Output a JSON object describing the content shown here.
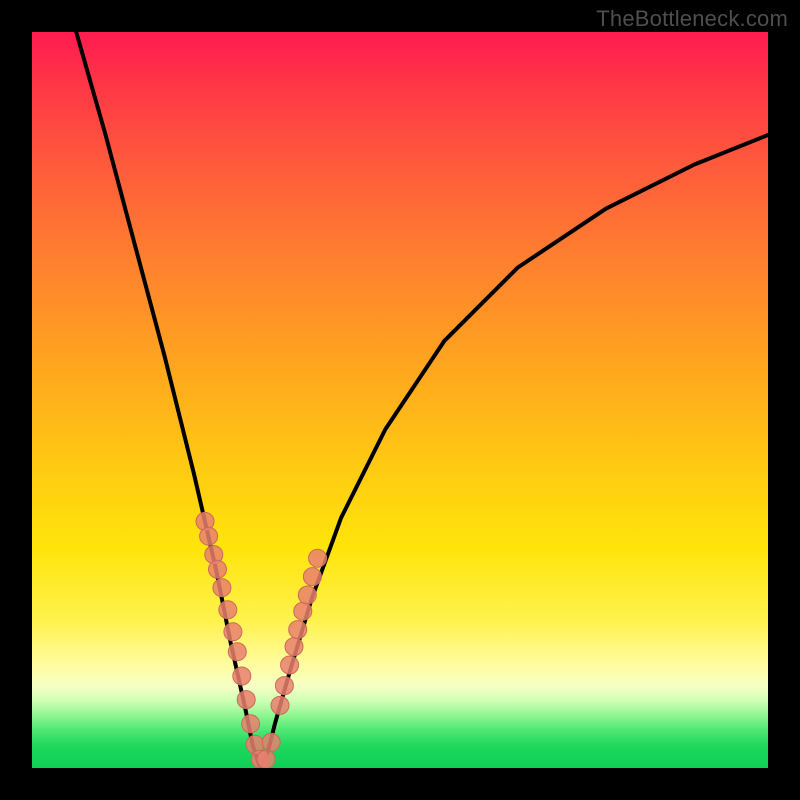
{
  "watermark": "TheBottleneck.com",
  "colors": {
    "frame": "#000000",
    "curve_stroke": "#000000",
    "marker_fill": "#e9806f",
    "marker_stroke": "#c96a5b"
  },
  "chart_data": {
    "type": "line",
    "title": "",
    "xlabel": "",
    "ylabel": "",
    "xlim": [
      0,
      100
    ],
    "ylim": [
      0,
      100
    ],
    "note": "x and y on 0-100 scale; y maps to bottleneck % (0 = green bottom, 100 = red top). V-shaped curve with trough near x≈31, y≈0.",
    "series": [
      {
        "name": "bottleneck-curve",
        "x": [
          6,
          10,
          14,
          18,
          22,
          25,
          27,
          29,
          30,
          31,
          32,
          33,
          35,
          38,
          42,
          48,
          56,
          66,
          78,
          90,
          100
        ],
        "y": [
          100,
          86,
          71,
          56,
          40,
          27,
          17,
          8,
          3,
          0,
          2,
          6,
          13,
          23,
          34,
          46,
          58,
          68,
          76,
          82,
          86
        ]
      },
      {
        "name": "marker-cluster",
        "type": "scatter",
        "x": [
          23.5,
          24.0,
          24.7,
          25.2,
          25.8,
          26.6,
          27.3,
          27.9,
          28.5,
          29.1,
          29.7,
          30.3,
          31.0,
          31.8,
          32.5,
          33.7,
          34.3,
          35.0,
          35.6,
          36.1,
          36.8,
          37.4,
          38.1,
          38.8
        ],
        "y": [
          33.5,
          31.5,
          29.0,
          27.0,
          24.5,
          21.5,
          18.5,
          15.8,
          12.5,
          9.3,
          6.0,
          3.2,
          1.2,
          1.2,
          3.5,
          8.5,
          11.2,
          14.0,
          16.5,
          18.8,
          21.3,
          23.5,
          26.0,
          28.5
        ]
      }
    ]
  }
}
